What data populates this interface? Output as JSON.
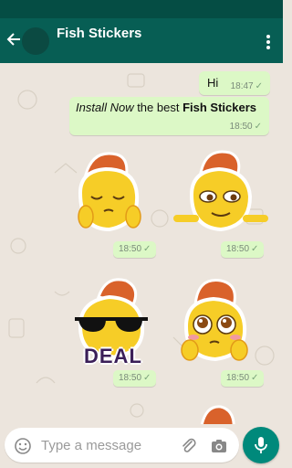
{
  "header": {
    "title": "Fish Stickers",
    "back_icon": "arrow-back-icon",
    "menu_icon": "more-vert-icon"
  },
  "messages": [
    {
      "text": "Hi",
      "time": "18:47",
      "status": "sent-tick"
    },
    {
      "segments": {
        "italic": "Install Now",
        "plain": " the best ",
        "bold": "Fish Stickers"
      },
      "time": "18:50",
      "status": "sent-tick"
    }
  ],
  "stickers": [
    {
      "name": "sticker-sleepy",
      "time": "18:50"
    },
    {
      "name": "sticker-pointing",
      "time": "18:50"
    },
    {
      "name": "sticker-deal",
      "caption": "DEAL",
      "time": "18:50"
    },
    {
      "name": "sticker-pleading",
      "time": "18:50"
    }
  ],
  "input": {
    "placeholder": "Type a message",
    "emoji_icon": "emoji-icon",
    "attach_icon": "paperclip-icon",
    "camera_icon": "camera-icon",
    "mic_icon": "mic-icon"
  },
  "colors": {
    "header": "#075e54",
    "status_bar": "#054d44",
    "bubble": "#dcf8c6",
    "chat_background": "#ece5dd",
    "fab": "#00897b"
  }
}
